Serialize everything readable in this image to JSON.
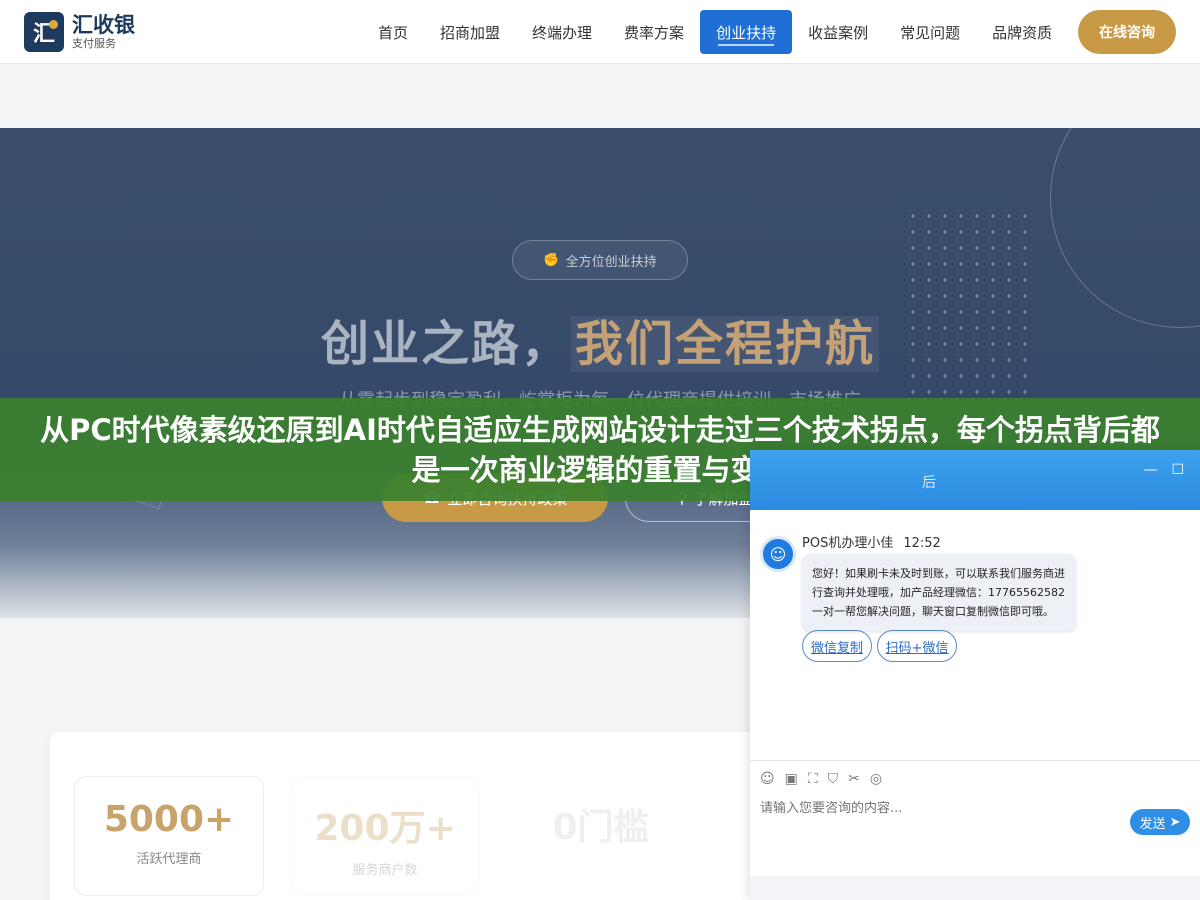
{
  "brand": {
    "mark": "汇",
    "title": "汇收银",
    "subtitle": "支付服务"
  },
  "nav": {
    "items": [
      "首页",
      "招商加盟",
      "终端办理",
      "费率方案",
      "创业扶持",
      "收益案例",
      "常见问题",
      "品牌资质"
    ],
    "active": "创业扶持",
    "cta": "在线咨询"
  },
  "hero": {
    "badge": "全方位创业扶持",
    "title_plain": "创业之路，",
    "title_highlight": "我们全程护航",
    "subtitle": "从零起步到稳定盈利，屹掌柜为每一位代理商提供培训、市场推广",
    "btn_primary": "立即咨询扶持政策",
    "btn_secondary": "了解加盟"
  },
  "stats": [
    {
      "value": "5000+",
      "label": "活跃代理商"
    },
    {
      "value": "200万+",
      "label": "服务商户数"
    },
    {
      "value": "0门槛",
      "label": ""
    }
  ],
  "banner": {
    "text": "从PC时代像素级还原到AI时代自适应生成网站设计走过三个技术拐点，每个拐点背后都是一次商业逻辑的重置与变革"
  },
  "chat": {
    "header_title": "后",
    "sender": "POS机办理小佳",
    "time": "12:52",
    "message": "您好！如果刷卡未及时到账，可以联系我们服务商进行查询并处理哦，加产品经理微信：17765562582 一对一帮您解决问题，聊天窗口复制微信即可哦。",
    "chips": [
      "微信复制",
      "扫码+微信"
    ],
    "input_placeholder": "请输入您要咨询的内容...",
    "send_label": "发送"
  },
  "colors": {
    "primary": "#1f6fd6",
    "gold": "#c99a45",
    "navy": "#1e3a5f",
    "banner_green": "#3a802e"
  }
}
